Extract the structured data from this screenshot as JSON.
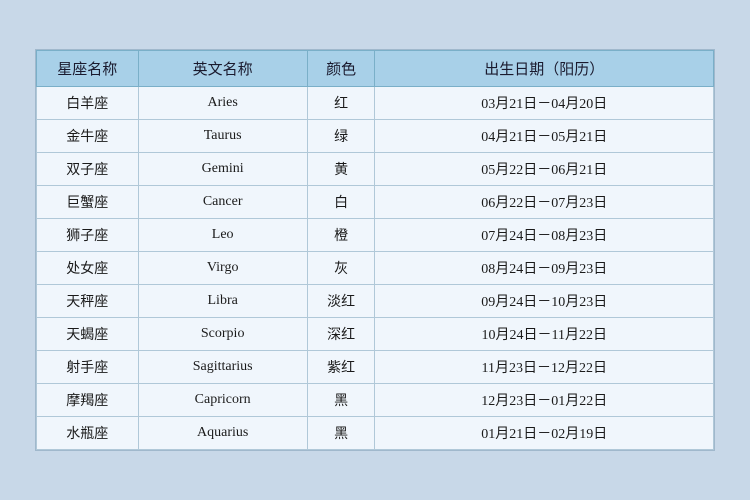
{
  "table": {
    "headers": [
      {
        "id": "col-cn",
        "label": "星座名称"
      },
      {
        "id": "col-en",
        "label": "英文名称"
      },
      {
        "id": "col-color",
        "label": "颜色"
      },
      {
        "id": "col-date",
        "label": "出生日期（阳历）"
      }
    ],
    "rows": [
      {
        "cn": "白羊座",
        "en": "Aries",
        "color": "红",
        "date": "03月21日－04月20日"
      },
      {
        "cn": "金牛座",
        "en": "Taurus",
        "color": "绿",
        "date": "04月21日－05月21日"
      },
      {
        "cn": "双子座",
        "en": "Gemini",
        "color": "黄",
        "date": "05月22日－06月21日"
      },
      {
        "cn": "巨蟹座",
        "en": "Cancer",
        "color": "白",
        "date": "06月22日－07月23日"
      },
      {
        "cn": "狮子座",
        "en": "Leo",
        "color": "橙",
        "date": "07月24日－08月23日"
      },
      {
        "cn": "处女座",
        "en": "Virgo",
        "color": "灰",
        "date": "08月24日－09月23日"
      },
      {
        "cn": "天秤座",
        "en": "Libra",
        "color": "淡红",
        "date": "09月24日－10月23日"
      },
      {
        "cn": "天蝎座",
        "en": "Scorpio",
        "color": "深红",
        "date": "10月24日－11月22日"
      },
      {
        "cn": "射手座",
        "en": "Sagittarius",
        "color": "紫红",
        "date": "11月23日－12月22日"
      },
      {
        "cn": "摩羯座",
        "en": "Capricorn",
        "color": "黑",
        "date": "12月23日－01月22日"
      },
      {
        "cn": "水瓶座",
        "en": "Aquarius",
        "color": "黑",
        "date": "01月21日－02月19日"
      }
    ]
  }
}
